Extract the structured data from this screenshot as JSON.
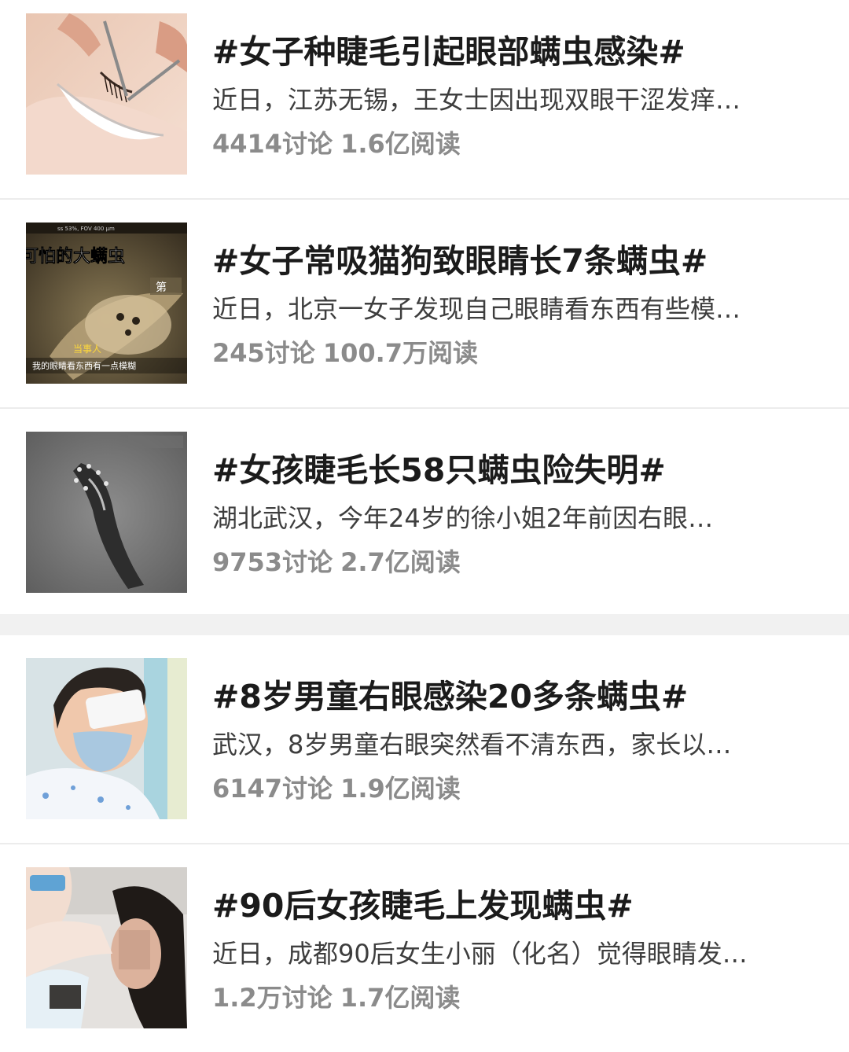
{
  "topics": [
    {
      "title": "#女子种睫毛引起眼部螨虫感染#",
      "summary": "近日，江苏无锡，王女士因出现双眼干涩发痒…",
      "discussions": "4414讨论",
      "reads": "1.6亿阅读",
      "thumb_icon": "eyelash-extension-photo"
    },
    {
      "title": "#女子常吸猫狗致眼睛长7条螨虫#",
      "summary": "近日，北京一女子发现自己眼睛看东西有些模…",
      "discussions": "245讨论",
      "reads": "100.7万阅读",
      "thumb_icon": "mite-microscope-video-still",
      "thumb_text": {
        "top": "ss 53%, FOV 400 μm",
        "headline": "可怕的大螨虫",
        "logo": "第",
        "speaker": "当事人",
        "subtitle": "我的眼睛看东西有一点模糊"
      }
    },
    {
      "title": "#女孩睫毛长58只螨虫险失明#",
      "summary": "湖北武汉，今年24岁的徐小姐2年前因右眼…",
      "discussions": "9753讨论",
      "reads": "2.7亿阅读",
      "thumb_icon": "mite-micrograph"
    },
    {
      "title": "#8岁男童右眼感染20多条螨虫#",
      "summary": "武汉，8岁男童右眼突然看不清东西，家长以…",
      "discussions": "6147讨论",
      "reads": "1.9亿阅读",
      "thumb_icon": "boy-with-eye-patch-photo"
    },
    {
      "title": "#90后女孩睫毛上发现螨虫#",
      "summary": "近日，成都90后女生小丽（化名）觉得眼睛发…",
      "discussions": "1.2万讨论",
      "reads": "1.7亿阅读",
      "thumb_icon": "eye-examination-photo"
    }
  ],
  "colors": {
    "title": "#1b1b1b",
    "summary": "#3e3e3e",
    "stats": "#8b8b8b",
    "divider": "#ececec",
    "section_gap": "#f1f1f1"
  }
}
